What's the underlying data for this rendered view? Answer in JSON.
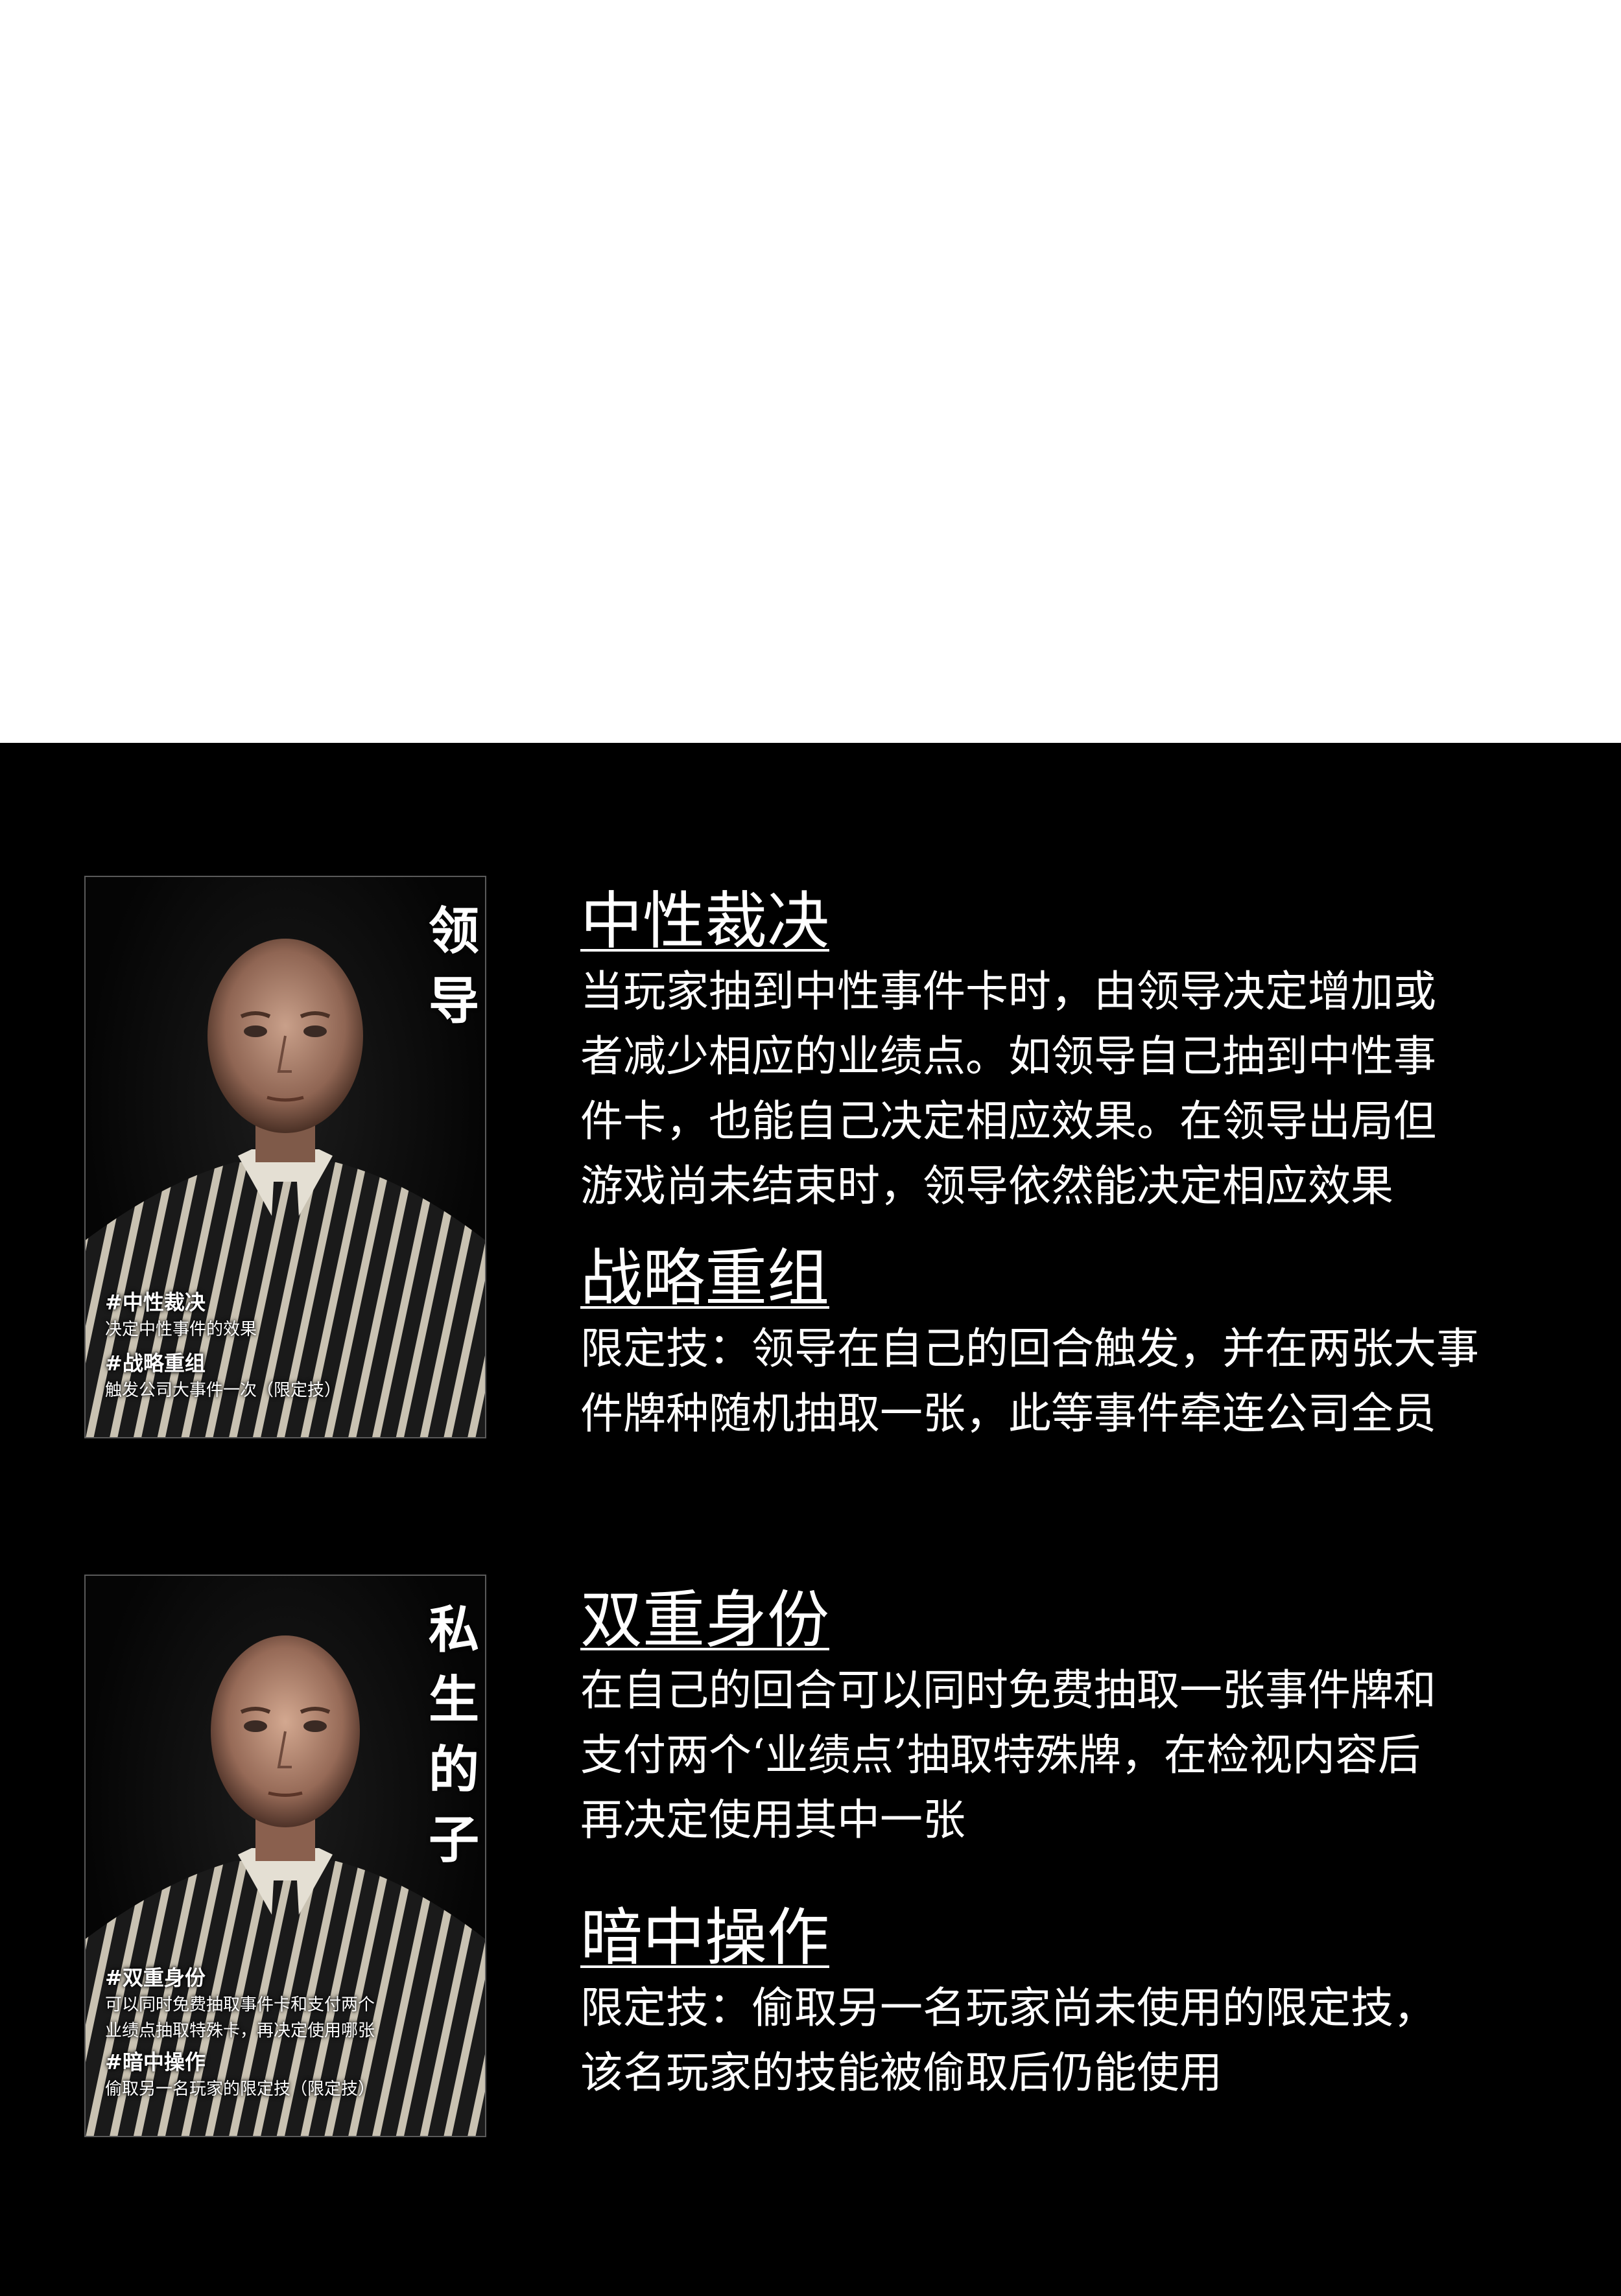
{
  "cards": [
    {
      "title_chars": [
        "领",
        "导"
      ],
      "small_skills": [
        {
          "name": "#中性裁决",
          "desc": "决定中性事件的效果"
        },
        {
          "name": "#战略重组",
          "desc": "触发公司大事件一次（限定技）"
        }
      ],
      "skills": [
        {
          "heading": "中性裁决",
          "lines": [
            "当玩家抽到中性事件卡时，由领导决定增加或",
            "者减少相应的业绩点。如领导自己抽到中性事",
            "件卡，也能自己决定相应效果。在领导出局但",
            "游戏尚未结束时，领导依然能决定相应效果"
          ]
        },
        {
          "heading": "战略重组",
          "lines": [
            "限定技：领导在自己的回合触发，并在两张大事",
            "件牌种随机抽取一张，此等事件牵连公司全员"
          ]
        }
      ]
    },
    {
      "title_chars": [
        "私",
        "生",
        "的",
        "子"
      ],
      "small_skills": [
        {
          "name": "#双重身份",
          "desc_lines": [
            "可以同时免费抽取事件卡和支付两个",
            "业绩点抽取特殊卡，再决定使用哪张"
          ]
        },
        {
          "name": "#暗中操作",
          "desc": "偷取另一名玩家的限定技（限定技）"
        }
      ],
      "skills": [
        {
          "heading": "双重身份",
          "lines": [
            "在自己的回合可以同时免费抽取一张事件牌和",
            "支付两个‘业绩点’抽取特殊牌，在检视内容后",
            "再决定使用其中一张"
          ]
        },
        {
          "heading": "暗中操作",
          "lines": [
            "限定技：偷取另一名玩家尚未使用的限定技，",
            "该名玩家的技能被偷取后仍能使用"
          ]
        }
      ]
    }
  ],
  "colors": {
    "background": "#000000",
    "text": "#ffffff",
    "card_border": "#5a5a5a"
  }
}
